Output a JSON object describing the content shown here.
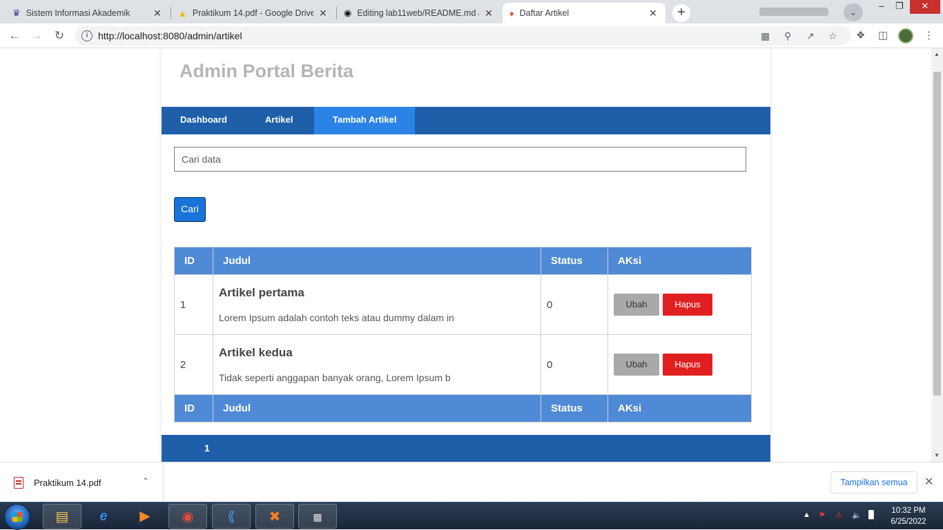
{
  "browser": {
    "tabs": [
      {
        "title": "Sistem Informasi Akademik",
        "icon": "university-icon"
      },
      {
        "title": "Praktikum 14.pdf - Google Drive",
        "icon": "google-drive-icon"
      },
      {
        "title": "Editing lab11web/README.md at",
        "icon": "github-icon"
      },
      {
        "title": "Daftar Artikel",
        "icon": "codeigniter-flame-icon",
        "active": true
      }
    ],
    "url": "http://localhost:8080/admin/artikel"
  },
  "site": {
    "title": "Admin Portal Berita",
    "nav": [
      {
        "label": "Dashboard"
      },
      {
        "label": "Artikel"
      },
      {
        "label": "Tambah Artikel",
        "active": true
      }
    ]
  },
  "search": {
    "placeholder": "Cari data",
    "button_label": "Cari"
  },
  "table": {
    "headers": [
      "ID",
      "Judul",
      "Status",
      "AKsi"
    ],
    "rows": [
      {
        "id": "1",
        "title": "Artikel pertama",
        "excerpt": "Lorem Ipsum adalah contoh teks atau dummy dalam in",
        "status": "0",
        "edit": "Ubah",
        "delete": "Hapus"
      },
      {
        "id": "2",
        "title": "Artikel kedua",
        "excerpt": "Tidak seperti anggapan banyak orang, Lorem Ipsum b",
        "status": "0",
        "edit": "Ubah",
        "delete": "Hapus"
      }
    ],
    "footer_headers": [
      "ID",
      "Judul",
      "Status",
      "AKsi"
    ]
  },
  "pagination": {
    "prev": "‹",
    "current": "1"
  },
  "downloads": {
    "file_name": "Praktikum 14.pdf",
    "show_all": "Tampilkan semua"
  },
  "taskbar": {
    "time": "10:32 PM",
    "date": "6/25/2022"
  },
  "colors": {
    "navbar": "#1f5faa",
    "nav_active": "#2b83e6",
    "table_header": "#4f8ad6",
    "delete_button": "#e02020",
    "edit_button": "#a9a9a9"
  }
}
